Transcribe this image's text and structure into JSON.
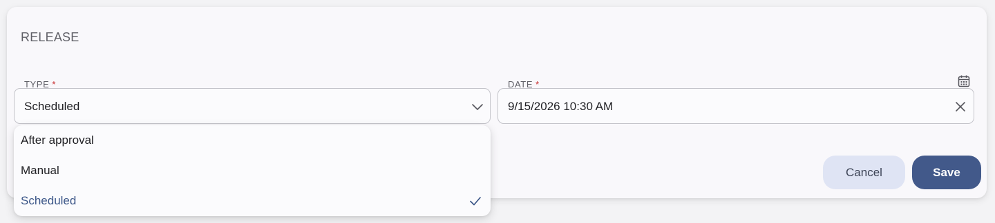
{
  "section": {
    "title": "RELEASE"
  },
  "type_field": {
    "label": "TYPE",
    "required_mark": "*",
    "value": "Scheduled",
    "options": [
      {
        "label": "After approval",
        "selected": false
      },
      {
        "label": "Manual",
        "selected": false
      },
      {
        "label": "Scheduled",
        "selected": true
      }
    ]
  },
  "date_field": {
    "label": "DATE",
    "required_mark": "*",
    "value": "9/15/2026 10:30 AM"
  },
  "actions": {
    "cancel_label": "Cancel",
    "save_label": "Save"
  },
  "colors": {
    "accent": "#42598a",
    "secondary_button": "#dfe4f4",
    "required": "#c62828",
    "selected_option_text": "#3b5688"
  },
  "icons": {
    "calendar": "calendar-icon",
    "dropdown": "chevron-down-icon",
    "clear": "close-icon",
    "selected": "check-icon"
  }
}
